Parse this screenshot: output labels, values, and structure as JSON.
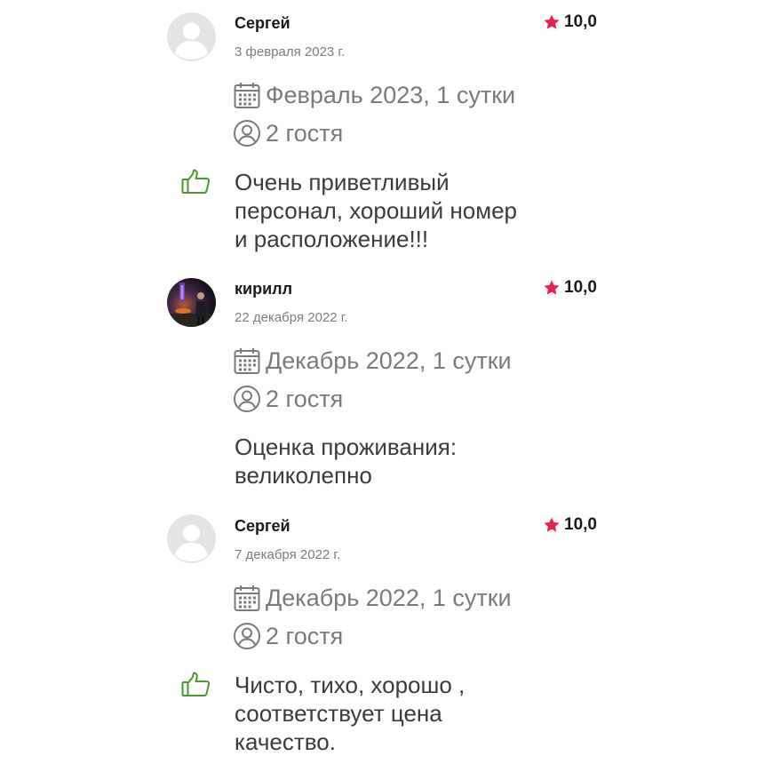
{
  "reviews": [
    {
      "author": "Сергей",
      "date": "3 февраля 2023 г.",
      "rating": "10,0",
      "stay": "Февраль 2023, 1 сутки",
      "guests": "2 гостя",
      "comment_lines": [
        "Очень приветливый",
        "персонал, хороший номер",
        "и расположение!!!"
      ],
      "has_thumb": true,
      "avatar": "default-avatar-icon"
    },
    {
      "author": "кирилл",
      "date": "22 декабря 2022 г.",
      "rating": "10,0",
      "stay": "Декабрь 2022, 1 сутки",
      "guests": "2 гостя",
      "comment_lines": [
        "Оценка проживания:",
        "великолепно"
      ],
      "has_thumb": false,
      "avatar": "user-photo"
    },
    {
      "author": "Сергей",
      "date": "7 декабря 2022 г.",
      "rating": "10,0",
      "stay": "Декабрь 2022, 1 сутки",
      "guests": "2 гостя",
      "comment_lines": [
        "Чисто, тихо, хорошо ,",
        "соответствует цена",
        "качество."
      ],
      "has_thumb": true,
      "avatar": "default-avatar-icon"
    }
  ],
  "colors": {
    "star": "#e8204e",
    "thumb": "#4a9a2a",
    "meta": "#7a7a7a",
    "avatar_bg": "#e3e3e3"
  },
  "icons": {
    "rating": "star-icon",
    "stay": "calendar-icon",
    "guests": "guests-icon",
    "positive": "thumbs-up-icon"
  }
}
